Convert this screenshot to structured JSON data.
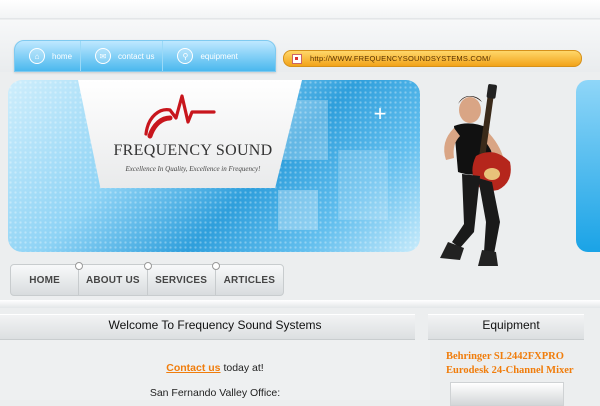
{
  "topnav": {
    "items": [
      {
        "label": "home",
        "icon": "home-icon"
      },
      {
        "label": "contact us",
        "icon": "mail-icon"
      },
      {
        "label": "equipment",
        "icon": "search-icon"
      }
    ]
  },
  "url_bar": {
    "text": "http://WWW.FREQUENCYSOUNDSYSTEMS.COM/"
  },
  "logo": {
    "title": "FREQUENCY SOUND",
    "tagline": "Excellence In Quality, Excellence in Frequency!"
  },
  "mainnav": {
    "items": [
      "HOME",
      "ABOUT US",
      "SERVICES",
      "ARTICLES"
    ]
  },
  "welcome": {
    "title": "Welcome To Frequency Sound Systems",
    "contact_link": "Contact us",
    "contact_rest": " today at!",
    "office": "San Fernando Valley Office:"
  },
  "equipment": {
    "title": "Equipment",
    "item_name": "Behringer SL2442FXPRO Eurodesk 24-Channel Mixer"
  },
  "colors": {
    "accent_orange": "#f07d0c",
    "nav_blue": "#4ab8ee",
    "logo_red": "#c8161d"
  }
}
